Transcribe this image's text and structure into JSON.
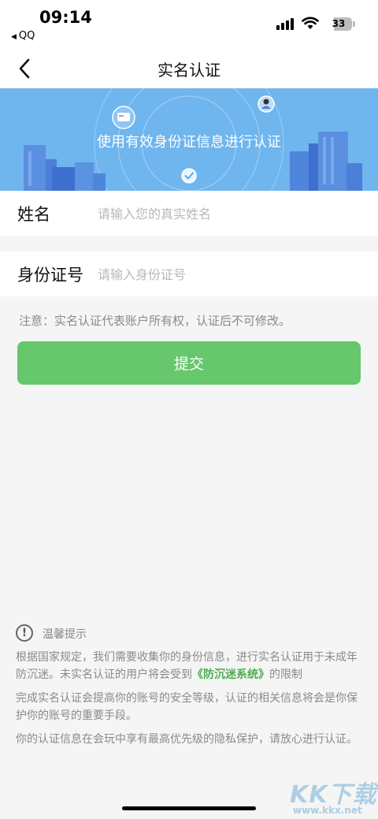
{
  "status_bar": {
    "time": "09:14",
    "back_app": "QQ",
    "battery": "33",
    "battery_level": 0.33
  },
  "nav": {
    "title": "实名认证"
  },
  "banner": {
    "text": "使用有效身份证信息进行认证"
  },
  "form": {
    "name_label": "姓名",
    "name_placeholder": "请输入您的真实姓名",
    "name_value": "",
    "id_label": "身份证号",
    "id_placeholder": "请输入身份证号",
    "id_value": ""
  },
  "notice": "注意：实名认证代表账户所有权，认证后不可修改。",
  "submit_label": "提交",
  "tips": {
    "title": "温馨提示",
    "p1_before": "根据国家规定，我们需要收集你的身份信息，进行实名认证用于未成年防沉迷。未实名认证的用户将会受到",
    "p1_link": "《防沉迷系统》",
    "p1_after": "的限制",
    "p2": "完成实名认证会提高你的账号的安全等级，认证的相关信息将会是你保护你的账号的重要手段。",
    "p3": "你的认证信息在会玩中享有最高优先级的隐私保护，请放心进行认证。"
  },
  "watermark": {
    "main": "KK下载",
    "url": "www.kkx.net"
  },
  "colors": {
    "banner": "#6fb5ee",
    "submit": "#66c76c",
    "link": "#4cae52"
  }
}
